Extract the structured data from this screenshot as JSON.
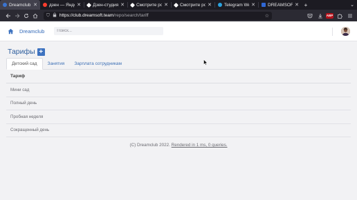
{
  "browser": {
    "tabs": [
      {
        "title": "Dreamclub",
        "favicon_color": "#3a74d0",
        "active": true
      },
      {
        "title": "дзен — Яндекс",
        "favicon_color": "#ff3d2e",
        "active": false
      },
      {
        "title": "Дзен-студия | …",
        "favicon_color": "#ffffff",
        "active": false
      },
      {
        "title": "Смотрите рол…",
        "favicon_color": "#ffffff",
        "active": false
      },
      {
        "title": "Смотрите рол…",
        "favicon_color": "#ffffff",
        "active": false
      },
      {
        "title": "Telegram Web",
        "favicon_color": "#2aa3e0",
        "active": false
      },
      {
        "title": "DREAMSOFT О…",
        "favicon_color": "#2f67d4",
        "active": false
      }
    ],
    "close_glyph": "✕",
    "new_tab_glyph": "+",
    "url_host": "https://club.dreamsoft.team",
    "url_path": "/repo/search/tariff",
    "abp_badge": "ABP"
  },
  "header": {
    "brand": "Dreamclub",
    "search_placeholder": "Поиск..."
  },
  "page": {
    "title": "Тарифы",
    "add_label": "+"
  },
  "tabs": [
    {
      "label": "Детский сад",
      "active": true
    },
    {
      "label": "Занятия",
      "active": false
    },
    {
      "label": "Зарплата сотрудникам",
      "active": false
    }
  ],
  "table": {
    "header": "Тариф",
    "rows": [
      "Мини сад",
      "Полный день",
      "Пробная неделя",
      "Сокращенный день"
    ]
  },
  "footer": {
    "prefix": "(C) Dreamclub 2022.",
    "rendered": "Rendered in 1 ms, 0 queries."
  },
  "colors": {
    "accent": "#3e73c0",
    "brand": "#2f67b7",
    "chrome_dark": "#1c1b22"
  }
}
